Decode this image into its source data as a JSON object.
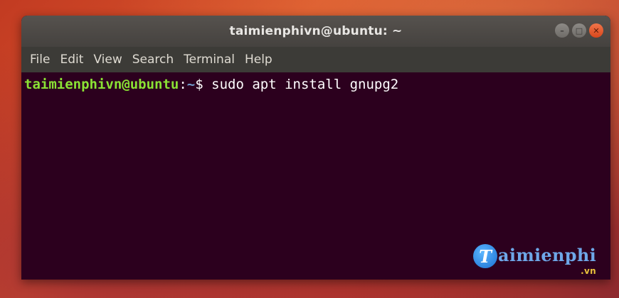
{
  "window": {
    "title": "taimienphivn@ubuntu: ~",
    "controls": {
      "minimize_icon": "minimize-icon",
      "maximize_icon": "maximize-icon",
      "close_icon": "close-icon"
    }
  },
  "menubar": {
    "items": [
      {
        "label": "File"
      },
      {
        "label": "Edit"
      },
      {
        "label": "View"
      },
      {
        "label": "Search"
      },
      {
        "label": "Terminal"
      },
      {
        "label": "Help"
      }
    ]
  },
  "terminal": {
    "prompt_user_host": "taimienphivn@ubuntu",
    "prompt_colon": ":",
    "prompt_path": "~",
    "prompt_symbol": "$ ",
    "command": "sudo apt install gnupg2"
  },
  "watermark": {
    "logo_letter": "T",
    "text": "aimienphi",
    "suffix": ".vn"
  },
  "colors": {
    "terminal_bg": "#2c001e",
    "prompt_user": "#8ae234",
    "prompt_path": "#729fcf",
    "close_button": "#e95420"
  }
}
